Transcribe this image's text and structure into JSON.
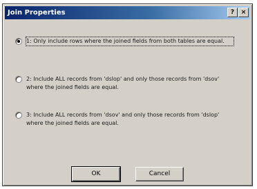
{
  "window": {
    "title": "Join Properties",
    "help_button": "?",
    "close_button": "×"
  },
  "options": [
    {
      "label": "1: Only include rows where the joined fields from both tables are equal.",
      "selected": true
    },
    {
      "label": "2: Include ALL records from 'dslop' and only those records from 'dsov' where the joined fields are equal.",
      "selected": false
    },
    {
      "label": "3: Include ALL records from 'dsov' and only those records from 'dslop' where the joined fields are equal.",
      "selected": false
    }
  ],
  "buttons": {
    "ok": "OK",
    "cancel": "Cancel"
  }
}
